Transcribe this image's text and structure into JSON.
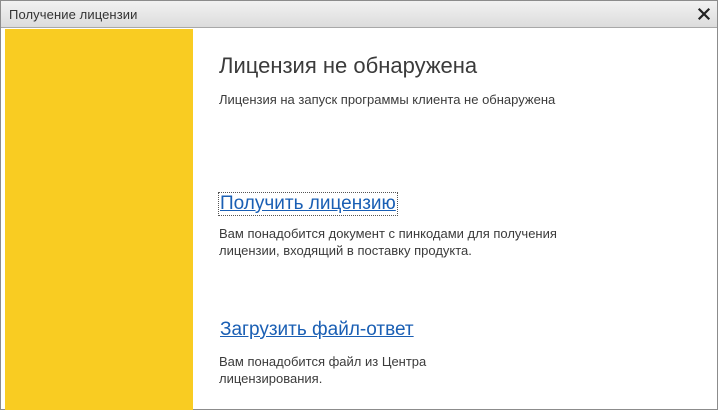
{
  "window": {
    "title": "Получение лицензии",
    "close_icon": "close-icon"
  },
  "colors": {
    "side_panel": "#f9cc22",
    "link": "#1a5fb4",
    "text": "#3b3b3b"
  },
  "main": {
    "heading": "Лицензия не обнаружена",
    "subheading": "Лицензия на запуск программы клиента не обнаружена",
    "options": [
      {
        "link": "Получить лицензию",
        "description": "Вам понадобится документ с пинкодами для получения лицензии, входящий в поставку продукта."
      },
      {
        "link": "Загрузить файл-ответ",
        "description": "Вам понадобится файл из Центра лицензирования."
      }
    ]
  }
}
